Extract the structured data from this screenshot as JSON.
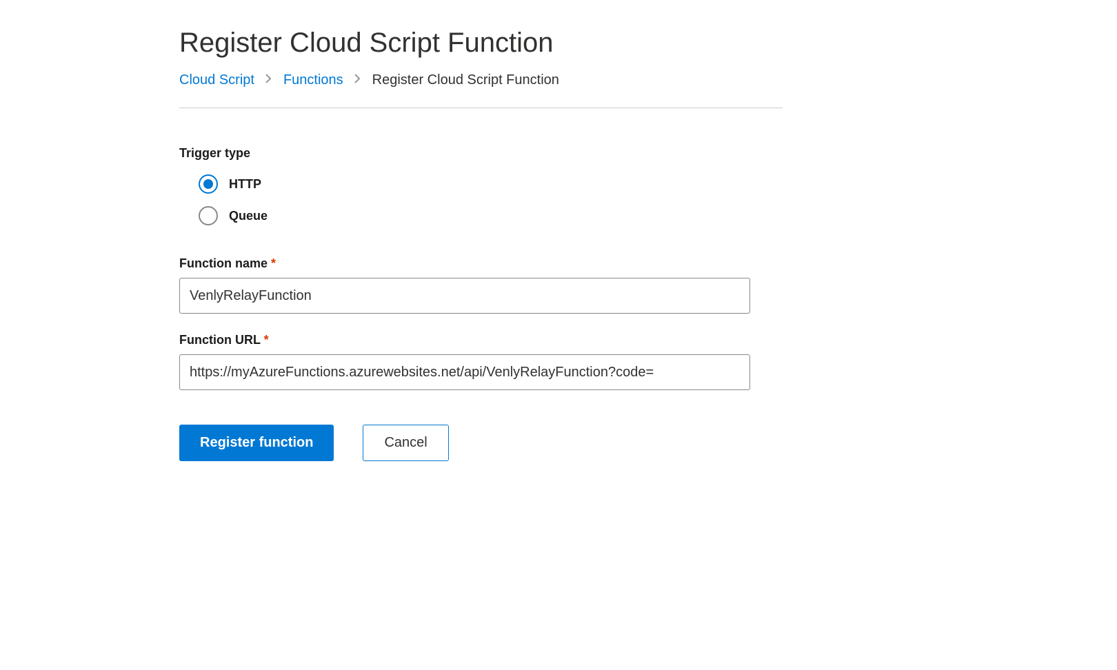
{
  "page": {
    "title": "Register Cloud Script Function"
  },
  "breadcrumb": {
    "items": [
      {
        "label": "Cloud Script",
        "link": true
      },
      {
        "label": "Functions",
        "link": true
      },
      {
        "label": "Register Cloud Script Function",
        "link": false
      }
    ]
  },
  "form": {
    "trigger_type": {
      "label": "Trigger type",
      "options": [
        {
          "value": "http",
          "label": "HTTP",
          "selected": true
        },
        {
          "value": "queue",
          "label": "Queue",
          "selected": false
        }
      ]
    },
    "function_name": {
      "label": "Function name",
      "required": true,
      "value": "VenlyRelayFunction"
    },
    "function_url": {
      "label": "Function URL",
      "required": true,
      "value": "https://myAzureFunctions.azurewebsites.net/api/VenlyRelayFunction?code="
    }
  },
  "buttons": {
    "primary": "Register function",
    "secondary": "Cancel"
  }
}
